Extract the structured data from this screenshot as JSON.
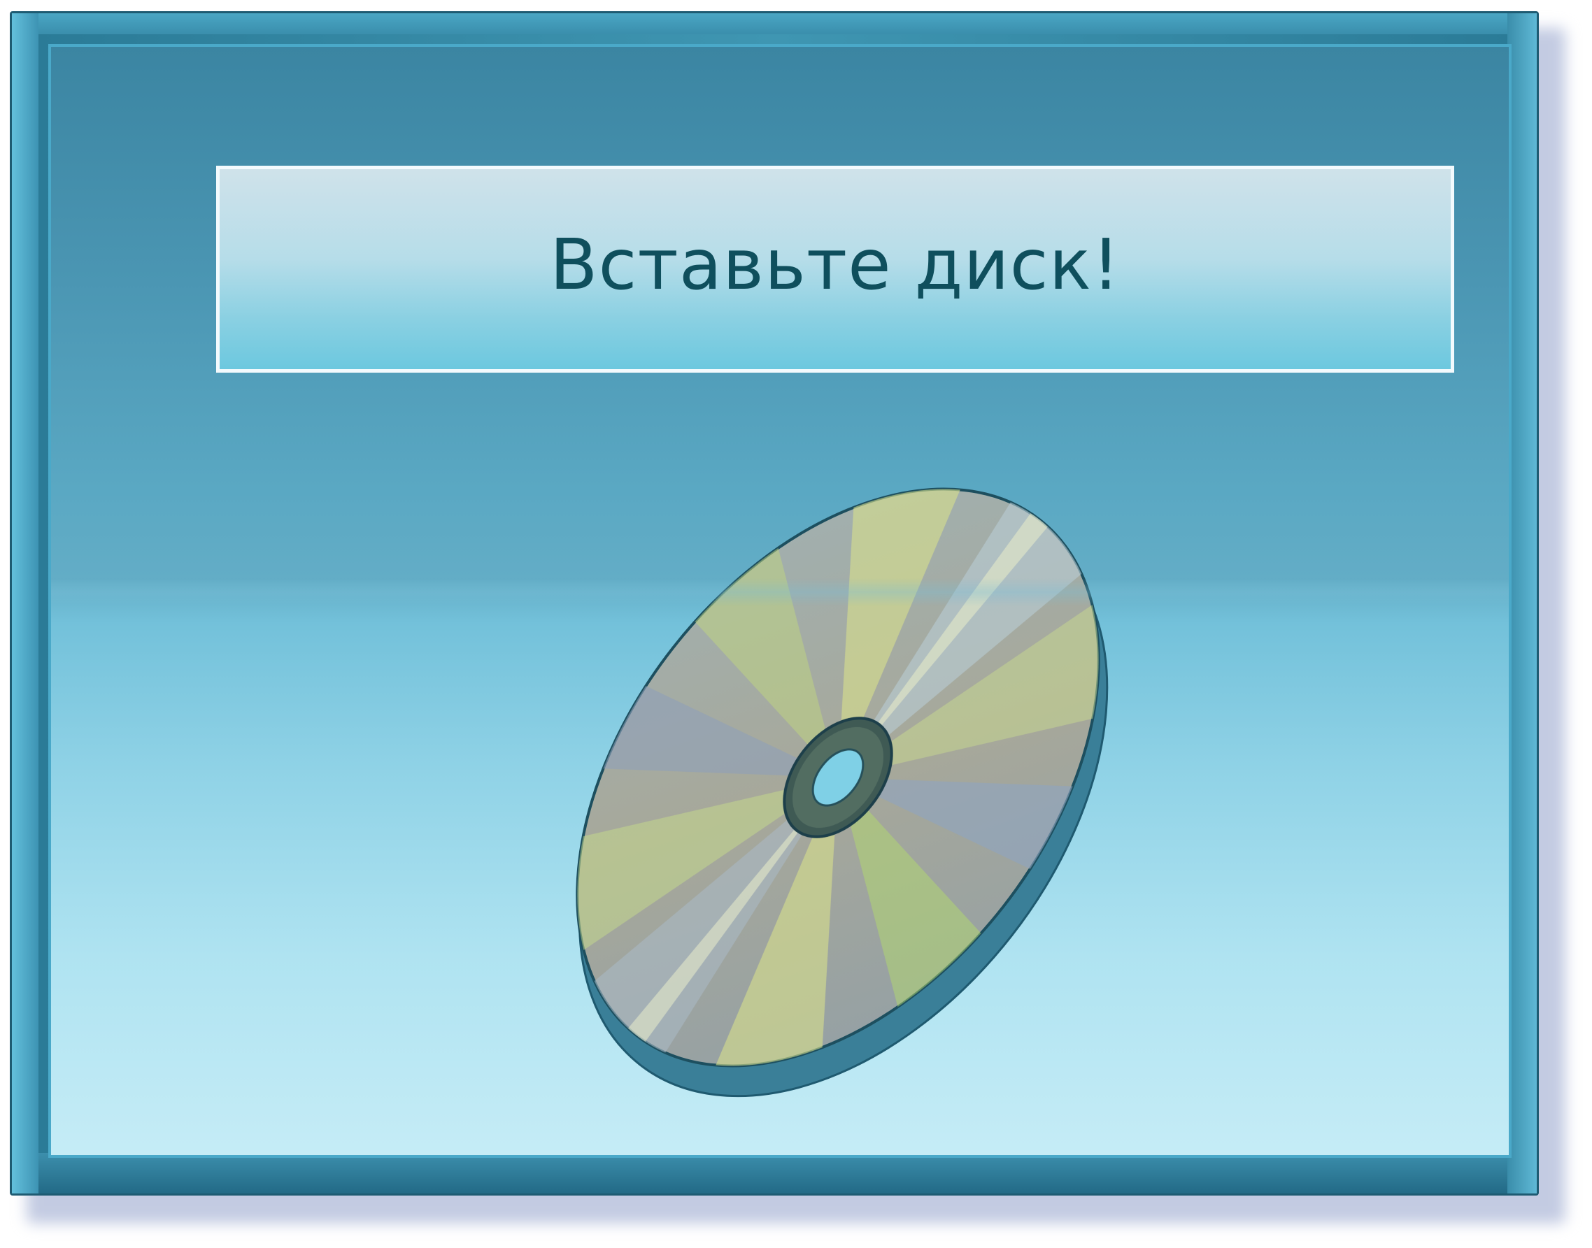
{
  "dialog": {
    "message": "Вставьте диск!"
  },
  "icons": {
    "disc": "cd-disc-icon"
  },
  "colors": {
    "frame_dark": "#1e5b72",
    "frame": "#3a8eac",
    "panel_top": "#3b85a2",
    "panel_bottom": "#c5ecf6",
    "banner": "#a9dbe8",
    "text": "#0f4f5d"
  }
}
